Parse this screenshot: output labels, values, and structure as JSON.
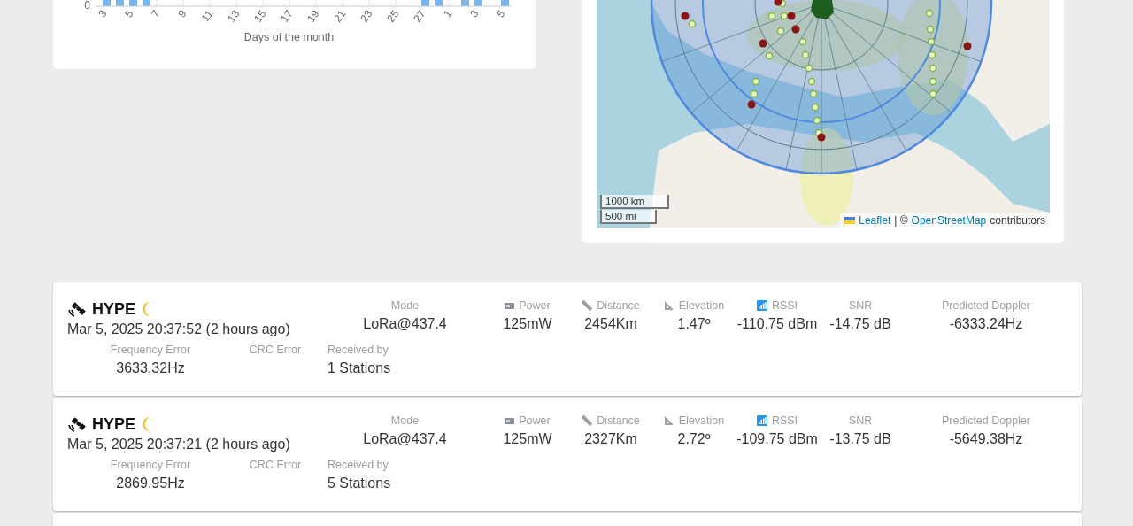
{
  "chart": {
    "y_tick": "0",
    "x_ticks": [
      "3",
      "5",
      "7",
      "9",
      "11",
      "13",
      "15",
      "17",
      "19",
      "21",
      "23",
      "25",
      "27",
      "1",
      "3",
      "5"
    ],
    "xlabel": "Days of the month"
  },
  "map": {
    "scale": [
      "1000 km",
      "500 mi"
    ],
    "attribution": {
      "leaflet": "Leaflet",
      "separator": "| ©",
      "osm": "OpenStreetMap",
      "suffix": "contributors"
    }
  },
  "packets": [
    {
      "name": "HYPE",
      "time": "Mar 5, 2025 20:37:52 (2 hours ago)",
      "metrics": [
        {
          "label": "Mode",
          "value": "LoRa@437.4"
        },
        {
          "label": "Power",
          "value": "125mW"
        },
        {
          "label": "Distance",
          "value": "2454Km"
        },
        {
          "label": "Elevation",
          "value": "1.47º"
        },
        {
          "label": "RSSI",
          "value": "-110.75 dBm"
        },
        {
          "label": "SNR",
          "value": "-14.75 dB"
        },
        {
          "label": "Predicted Doppler",
          "value": "-6333.24Hz"
        }
      ],
      "details": [
        {
          "label": "Frequency Error",
          "value": "3633.32Hz"
        },
        {
          "label": "CRC Error"
        },
        {
          "label": "Received by",
          "value": "1 Stations"
        }
      ]
    },
    {
      "name": "HYPE",
      "time": "Mar 5, 2025 20:37:21 (2 hours ago)",
      "metrics": [
        {
          "label": "Mode",
          "value": "LoRa@437.4"
        },
        {
          "label": "Power",
          "value": "125mW"
        },
        {
          "label": "Distance",
          "value": "2327Km"
        },
        {
          "label": "Elevation",
          "value": "2.72º"
        },
        {
          "label": "RSSI",
          "value": "-109.75 dBm"
        },
        {
          "label": "SNR",
          "value": "-13.75 dB"
        },
        {
          "label": "Predicted Doppler",
          "value": "-5649.38Hz"
        }
      ],
      "details": [
        {
          "label": "Frequency Error",
          "value": "2869.95Hz"
        },
        {
          "label": "CRC Error"
        },
        {
          "label": "Received by",
          "value": "5 Stations"
        }
      ]
    }
  ]
}
